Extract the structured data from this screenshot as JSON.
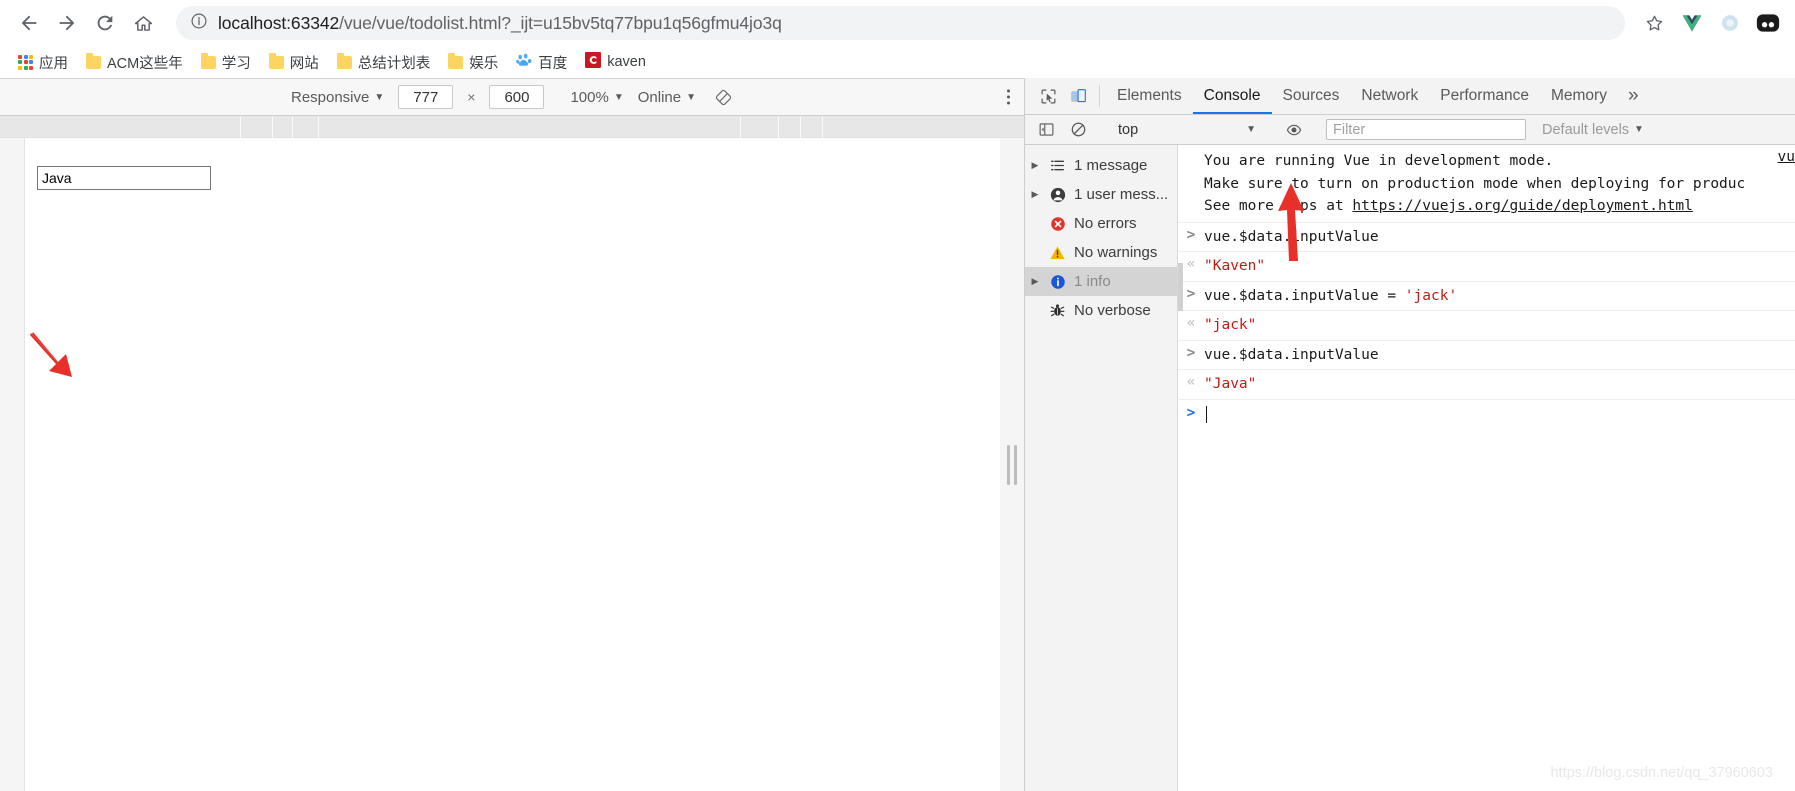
{
  "browser": {
    "nav": {
      "back_label": "Back",
      "forward_label": "Forward",
      "reload_label": "Reload",
      "home_label": "Home",
      "back_icon": "arrow-left-icon",
      "forward_icon": "arrow-right-icon",
      "reload_icon": "reload-icon",
      "home_icon": "home-icon"
    },
    "omnibox": {
      "info_icon": "page-info-icon",
      "url_host": "localhost:63342",
      "url_path": "/vue/vue/todolist.html?_ijt=u15bv5tq77bpu1q56gfmu4jo3q",
      "full_url": "localhost:63342/vue/vue/todolist.html?_ijt=u15bv5tq77bpu1q56gfmu4jo3q"
    },
    "toolbar_icons": [
      {
        "name": "bookmark-star-icon",
        "glyph": "star"
      },
      {
        "name": "vue-devtools-icon",
        "glyph": "vue"
      },
      {
        "name": "extension-circle-icon",
        "glyph": "circle"
      },
      {
        "name": "profile-avatar-icon",
        "glyph": "avatar"
      }
    ],
    "bookmarks": [
      {
        "label": "应用",
        "icon": "apps-grid-icon"
      },
      {
        "label": "ACM这些年",
        "icon": "folder-icon"
      },
      {
        "label": "学习",
        "icon": "folder-icon"
      },
      {
        "label": "网站",
        "icon": "folder-icon"
      },
      {
        "label": "总结计划表",
        "icon": "folder-icon"
      },
      {
        "label": "娱乐",
        "icon": "folder-icon"
      },
      {
        "label": "百度",
        "icon": "baidu-icon"
      },
      {
        "label": "kaven",
        "icon": "csdn-icon"
      }
    ]
  },
  "device_toolbar": {
    "device": "Responsive",
    "width": "777",
    "height": "600",
    "zoom": "100%",
    "throttling": "Online",
    "rotate_icon": "rotate-device-icon",
    "menu_icon": "kebab-menu-icon"
  },
  "page": {
    "input_value": "Java",
    "input_placeholder": ""
  },
  "devtools": {
    "left_icons": [
      {
        "name": "inspect-element-icon"
      },
      {
        "name": "toggle-device-toolbar-icon",
        "active": true
      }
    ],
    "tabs": [
      {
        "label": "Elements",
        "active": false
      },
      {
        "label": "Console",
        "active": true
      },
      {
        "label": "Sources",
        "active": false
      },
      {
        "label": "Network",
        "active": false
      },
      {
        "label": "Performance",
        "active": false
      },
      {
        "label": "Memory",
        "active": false
      }
    ],
    "more_tabs_label": "»",
    "console_toolbar": {
      "sidebar_toggle_icon": "console-sidebar-toggle-icon",
      "clear_icon": "clear-console-icon",
      "context": "top",
      "eye_icon": "live-expression-icon",
      "filter_placeholder": "Filter",
      "filter_value": "",
      "levels": "Default levels"
    },
    "sidebar": [
      {
        "label": "1 message",
        "icon": "list-icon",
        "expandable": true,
        "selected": false,
        "dim": false
      },
      {
        "label": "1 user mess...",
        "icon": "user-icon",
        "expandable": true,
        "selected": false,
        "dim": false
      },
      {
        "label": "No errors",
        "icon": "error-icon",
        "expandable": false,
        "selected": false,
        "dim": false
      },
      {
        "label": "No warnings",
        "icon": "warning-icon",
        "expandable": false,
        "selected": false,
        "dim": false
      },
      {
        "label": "1 info",
        "icon": "info-icon",
        "expandable": true,
        "selected": true,
        "dim": true
      },
      {
        "label": "No verbose",
        "icon": "bug-icon",
        "expandable": false,
        "selected": false,
        "dim": false
      }
    ],
    "messages": {
      "vue_warning": {
        "line1": "You are running Vue in development mode.",
        "line2": "Make sure to turn on production mode when deploying for produc",
        "line3_prefix": "See more tips at ",
        "line3_link": "https://vuejs.org/guide/deployment.html",
        "source_link": "vu"
      },
      "entries": [
        {
          "kind": "input",
          "marker": ">",
          "text": "vue.$data.inputValue"
        },
        {
          "kind": "output",
          "marker": "«",
          "text": "\"Kaven\""
        },
        {
          "kind": "input",
          "marker": ">",
          "text": "vue.$data.inputValue = 'jack'"
        },
        {
          "kind": "output",
          "marker": "«",
          "text": "\"jack\""
        },
        {
          "kind": "input",
          "marker": ">",
          "text": "vue.$data.inputValue"
        },
        {
          "kind": "output",
          "marker": "«",
          "text": "\"Java\""
        }
      ],
      "prompt_marker": ">",
      "prompt_value": ""
    }
  },
  "annotations": [
    {
      "name": "arrow-pointing-to-input",
      "color": "#e8302a"
    },
    {
      "name": "arrow-pointing-to-console-prompt",
      "color": "#e8302a"
    }
  ],
  "watermark": "https://blog.csdn.net/qq_37960603",
  "colors": {
    "accent": "#1a73e8",
    "error": "#e8302a",
    "warning": "#f4b400",
    "info": "#1a73e8",
    "string": "#c41a16",
    "annotation": "#e8302a"
  }
}
